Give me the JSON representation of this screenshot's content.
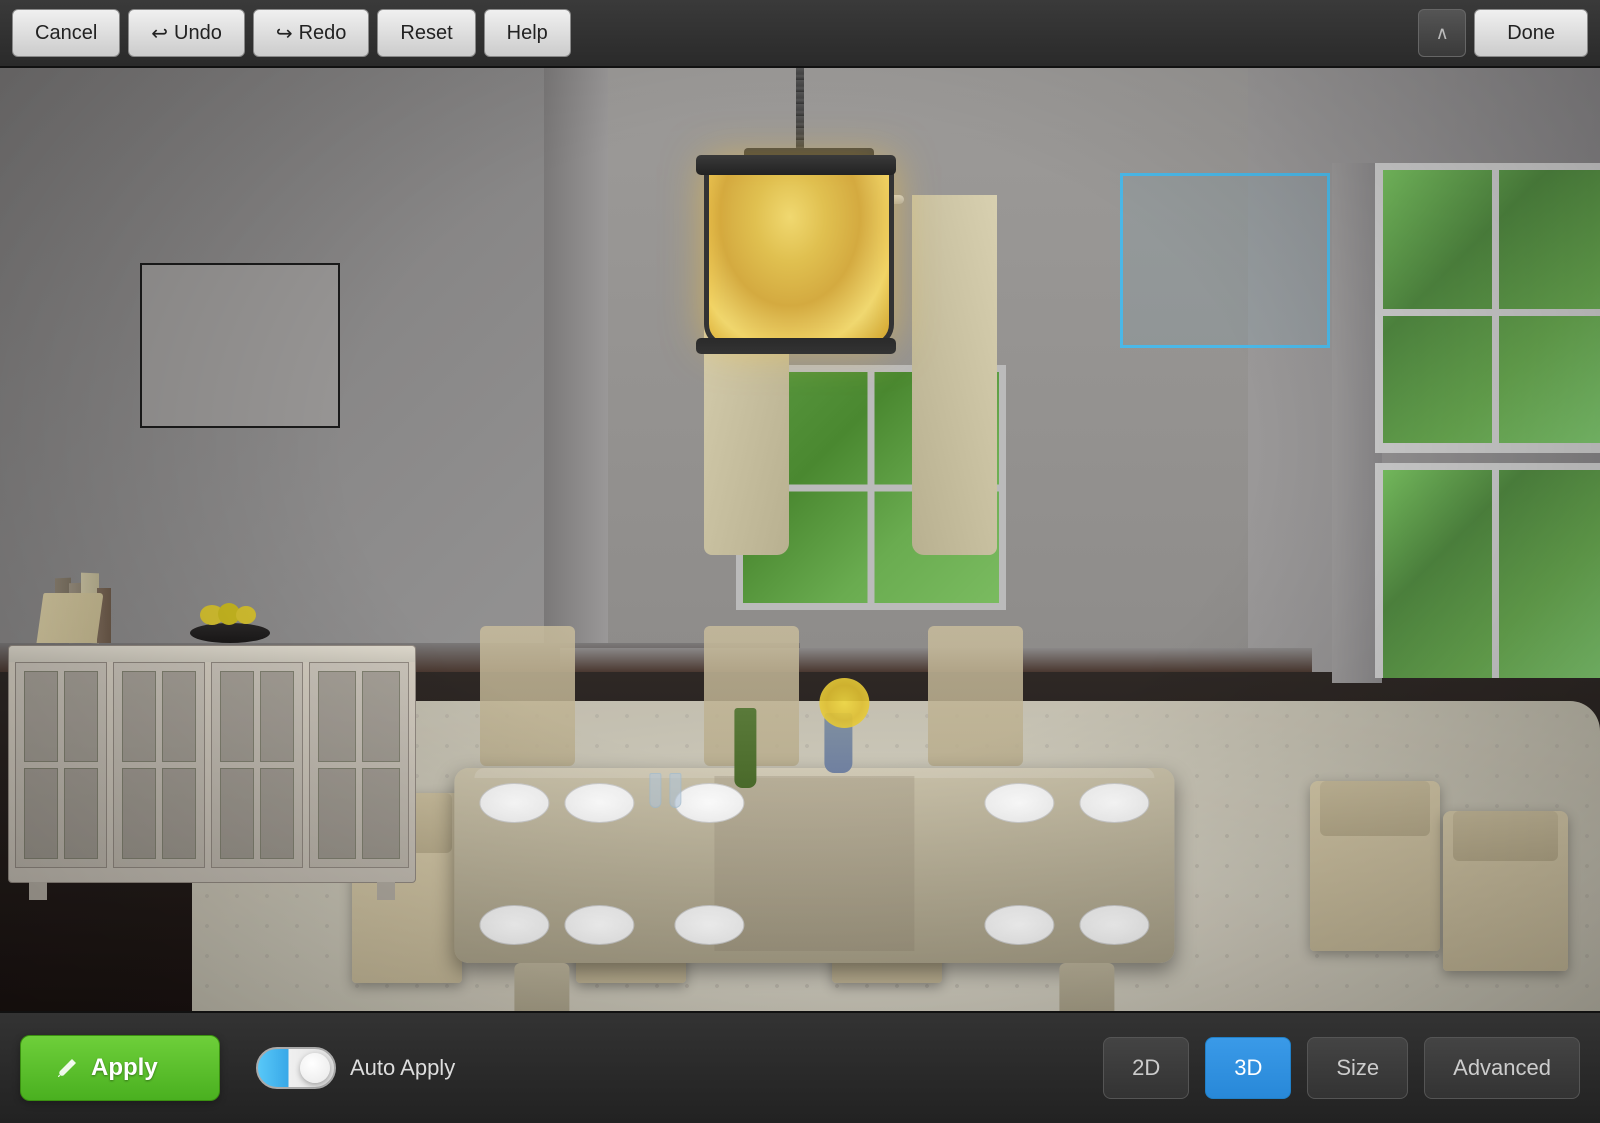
{
  "toolbar": {
    "cancel_label": "Cancel",
    "undo_label": "Undo",
    "redo_label": "Redo",
    "reset_label": "Reset",
    "help_label": "Help",
    "done_label": "Done"
  },
  "bottom_bar": {
    "apply_label": "Apply",
    "auto_apply_label": "Auto Apply",
    "btn_2d_label": "2D",
    "btn_3d_label": "3D",
    "size_label": "Size",
    "advanced_label": "Advanced"
  },
  "icons": {
    "undo_arrow": "↩",
    "redo_arrow": "↪",
    "chevron_up": "∧",
    "paint_brush": "🖌",
    "toggle_on": "ON"
  },
  "scene": {
    "wall_art_visible": true,
    "selection_rect_visible": true
  }
}
